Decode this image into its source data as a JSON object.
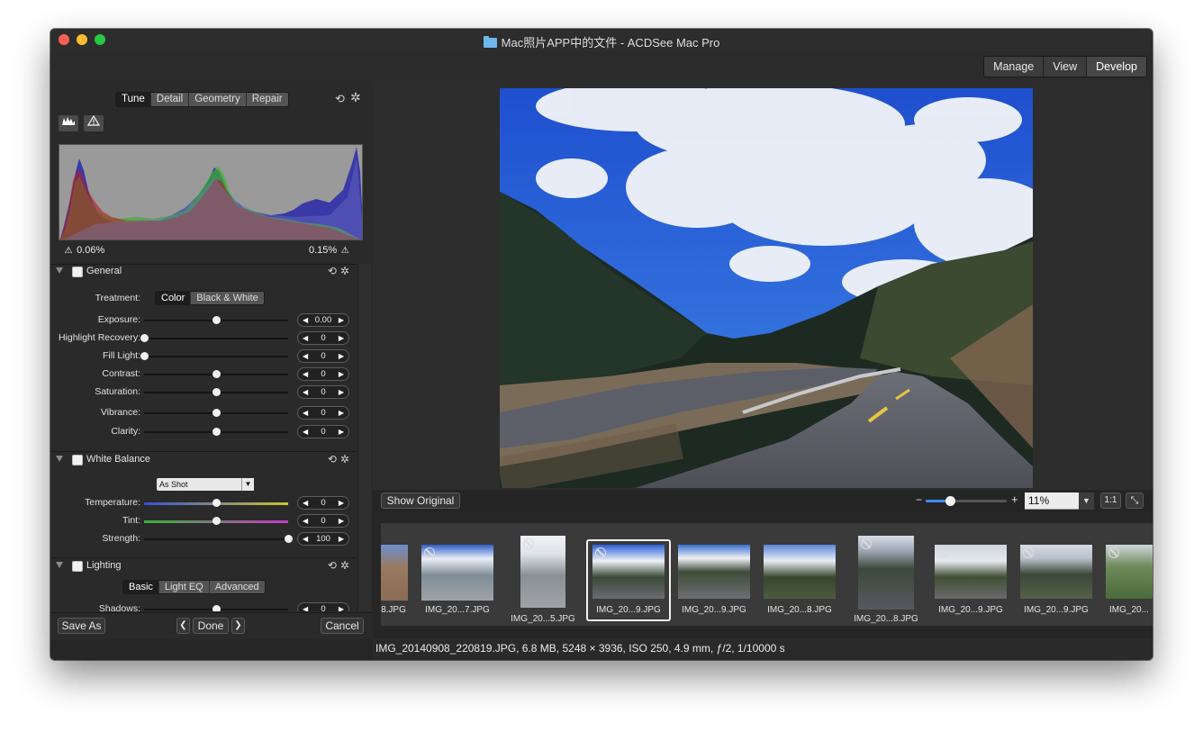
{
  "window": {
    "title": "Mac照片APP中的文件 - ACDSee Mac Pro"
  },
  "modes": [
    {
      "label": "Manage",
      "active": false
    },
    {
      "label": "View",
      "active": false
    },
    {
      "label": "Develop",
      "active": true
    }
  ],
  "tabs": [
    {
      "label": "Tune",
      "active": true
    },
    {
      "label": "Detail",
      "active": false
    },
    {
      "label": "Geometry",
      "active": false
    },
    {
      "label": "Repair",
      "active": false
    }
  ],
  "histogram": {
    "shadow_clip": "0.06%",
    "highlight_clip": "0.15%"
  },
  "general": {
    "label": "General",
    "treatment_label": "Treatment:",
    "treatment_options": [
      {
        "label": "Color",
        "active": true
      },
      {
        "label": "Black & White",
        "active": false
      }
    ],
    "sliders": [
      {
        "label": "Exposure:",
        "value": "0.00",
        "position": 0.5
      },
      {
        "label": "Highlight Recovery:",
        "value": "0",
        "position": 0.0
      },
      {
        "label": "Fill Light:",
        "value": "0",
        "position": 0.0
      },
      {
        "label": "Contrast:",
        "value": "0",
        "position": 0.5
      },
      {
        "label": "Saturation:",
        "value": "0",
        "position": 0.5
      },
      {
        "label": "Vibrance:",
        "value": "0",
        "position": 0.5
      },
      {
        "label": "Clarity:",
        "value": "0",
        "position": 0.5
      }
    ]
  },
  "white_balance": {
    "label": "White Balance",
    "preset": "As Shot",
    "sliders": [
      {
        "label": "Temperature:",
        "value": "0",
        "position": 0.5
      },
      {
        "label": "Tint:",
        "value": "0",
        "position": 0.5
      },
      {
        "label": "Strength:",
        "value": "100",
        "position": 1.0
      }
    ]
  },
  "lighting": {
    "label": "Lighting",
    "modes": [
      {
        "label": "Basic",
        "active": true
      },
      {
        "label": "Light EQ",
        "active": false
      },
      {
        "label": "Advanced",
        "active": false
      }
    ],
    "partial_label": "Shadows:",
    "partial_value": "0"
  },
  "bottom_buttons": {
    "save_as": "Save As",
    "prev": "❮",
    "done": "Done",
    "next": "❯",
    "cancel": "Cancel"
  },
  "viewer": {
    "show_original": "Show Original",
    "zoom_minus": "−",
    "zoom_plus": "+",
    "zoom_value": "11%",
    "zoom_fraction": 0.3,
    "one_to_one": "1:1"
  },
  "filmstrip": [
    {
      "caption": "8.JPG",
      "selected": false,
      "flag": false
    },
    {
      "caption": "IMG_20...7.JPG",
      "selected": false,
      "flag": true
    },
    {
      "caption": "IMG_20...5.JPG",
      "selected": false,
      "flag": true
    },
    {
      "caption": "IMG_20...9.JPG",
      "selected": true,
      "flag": true
    },
    {
      "caption": "IMG_20...9.JPG",
      "selected": false,
      "flag": false
    },
    {
      "caption": "IMG_20...8.JPG",
      "selected": false,
      "flag": false
    },
    {
      "caption": "IMG_20...8.JPG",
      "selected": false,
      "flag": true
    },
    {
      "caption": "IMG_20...9.JPG",
      "selected": false,
      "flag": true
    },
    {
      "caption": "IMG_20...9.JPG",
      "selected": false,
      "flag": true
    },
    {
      "caption": "IMG_20...",
      "selected": false,
      "flag": true
    }
  ],
  "status": {
    "text": "IMG_20140908_220819.JPG, 6.8 MB, 5248 × 3936, ISO 250, 4.9 mm, ƒ/2, 1/10000 s"
  },
  "colors": {
    "accent": "#3a8ef0",
    "window_bg": "#262626",
    "sky": "#2a66d8"
  }
}
